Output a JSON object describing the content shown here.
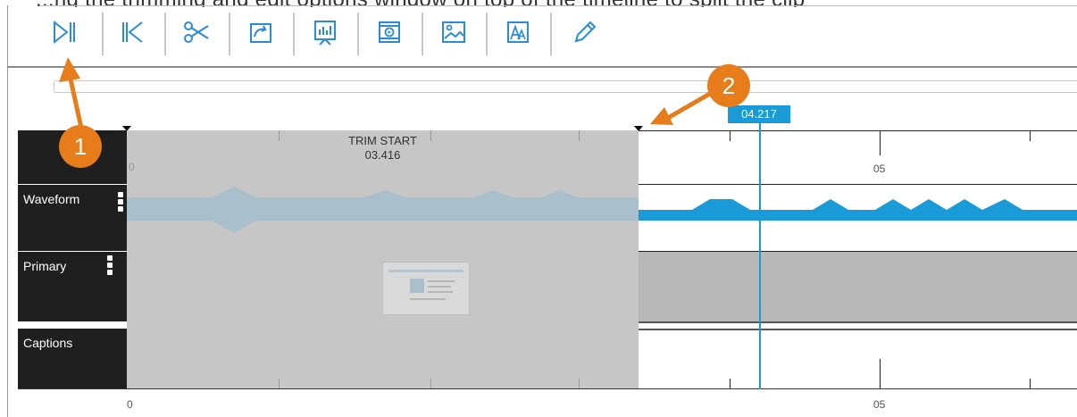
{
  "page": {
    "top_clipped_text": "...ng the trimming and edit options window on top of the timeline to split the clip"
  },
  "toolbar": {
    "tools": [
      {
        "name": "split",
        "icon": "split-at-playhead-icon"
      },
      {
        "name": "go-to-start",
        "icon": "go-to-start-icon"
      },
      {
        "name": "cut",
        "icon": "scissors-icon"
      },
      {
        "name": "undo",
        "icon": "undo-icon"
      },
      {
        "name": "chart",
        "icon": "presentation-chart-icon"
      },
      {
        "name": "video",
        "icon": "video-icon"
      },
      {
        "name": "image",
        "icon": "image-icon"
      },
      {
        "name": "text",
        "icon": "text-icon"
      },
      {
        "name": "edit",
        "icon": "pencil-icon"
      }
    ]
  },
  "timeline": {
    "trim_start_title": "TRIM START",
    "trim_start_time": "03.416",
    "playhead_time": "04.217",
    "ruler_labels": {
      "zero": "0",
      "five": "05"
    }
  },
  "tracks": {
    "waveform": {
      "label": "Waveform"
    },
    "primary": {
      "label": "Primary"
    },
    "captions": {
      "label": "Captions"
    }
  },
  "callouts": {
    "one": "1",
    "two": "2"
  },
  "colors": {
    "accent": "#1a9ad6",
    "callout": "#e67c1a",
    "trim_overlay": "#c6c6c6",
    "track_header": "#1f1f1f"
  }
}
